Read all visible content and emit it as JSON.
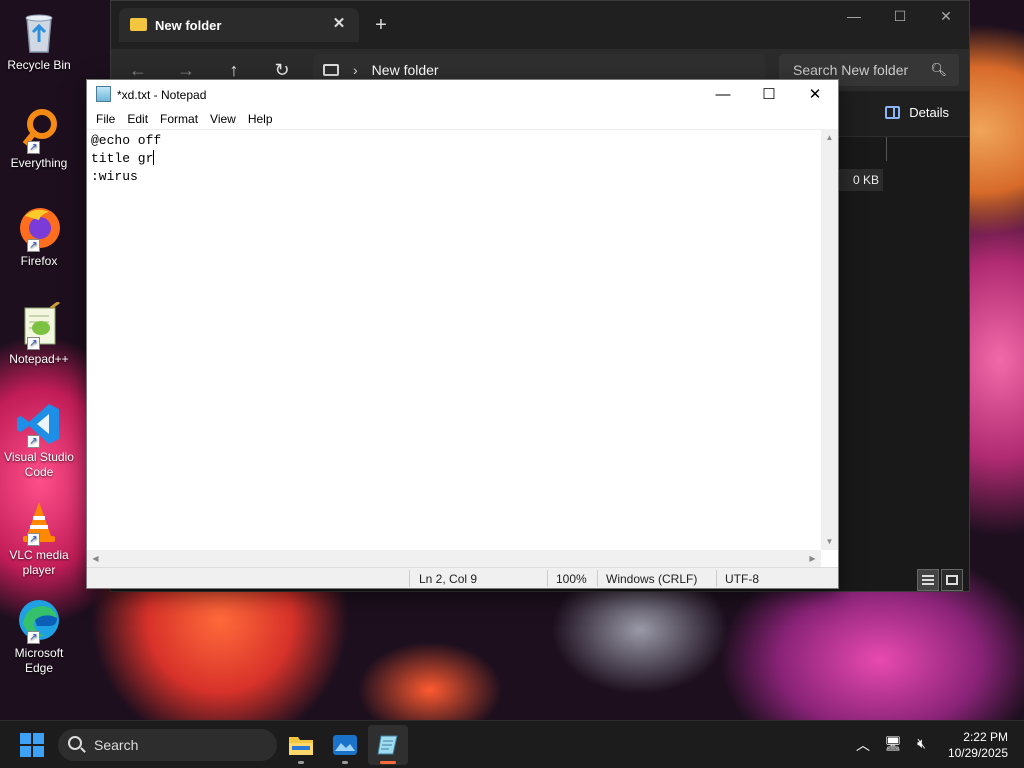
{
  "desktop": {
    "icons": [
      {
        "label": "Recycle Bin",
        "icon": "recycle-bin-icon"
      },
      {
        "label": "Everything",
        "icon": "everything-search-icon"
      },
      {
        "label": "Firefox",
        "icon": "firefox-icon"
      },
      {
        "label": "Notepad++",
        "icon": "notepad-plus-plus-icon"
      },
      {
        "label": "Visual Studio Code",
        "icon": "vscode-icon"
      },
      {
        "label": "VLC media player",
        "icon": "vlc-icon"
      },
      {
        "label": "Microsoft Edge",
        "icon": "edge-icon"
      }
    ]
  },
  "explorer": {
    "tab_title": "New folder",
    "new_tab": "+",
    "breadcrumb": "New folder",
    "search_placeholder": "Search New folder",
    "details_label": "Details",
    "file_size": "0 KB"
  },
  "notepad": {
    "title": "*xd.txt - Notepad",
    "menu": [
      "File",
      "Edit",
      "Format",
      "View",
      "Help"
    ],
    "lines": [
      "@echo off",
      "title gr",
      ":wirus"
    ],
    "status": {
      "position": "Ln 2, Col 9",
      "zoom": "100%",
      "line_ending": "Windows (CRLF)",
      "encoding": "UTF-8"
    }
  },
  "taskbar": {
    "search_label": "Search",
    "time": "2:22 PM",
    "date": "10/29/2025",
    "accent": "#ff6a3d"
  }
}
